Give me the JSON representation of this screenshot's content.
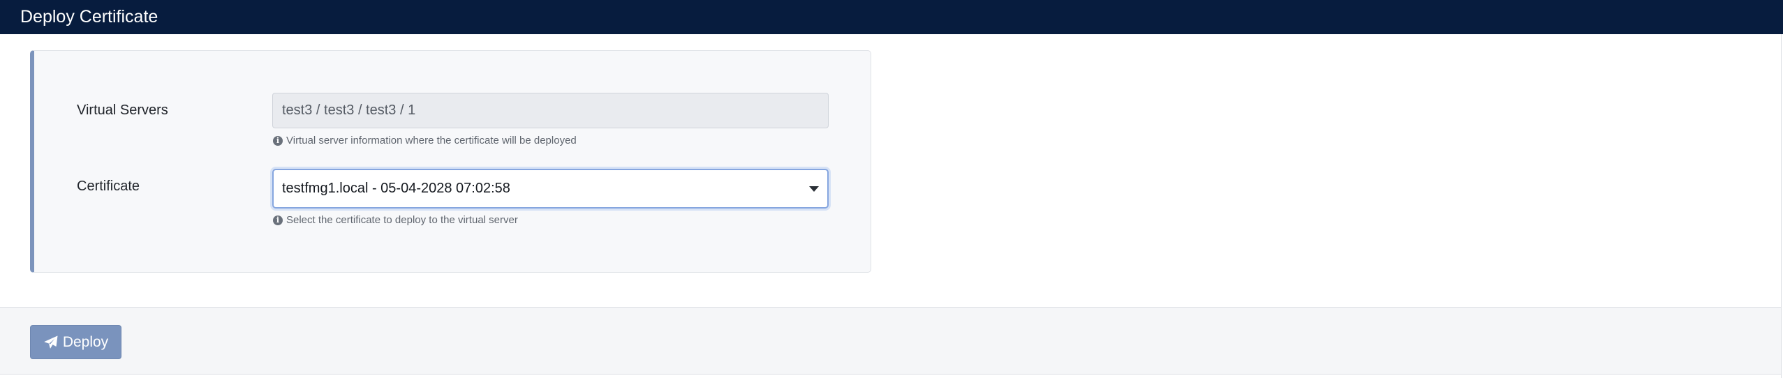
{
  "header": {
    "title": "Deploy Certificate"
  },
  "form": {
    "virtual_servers": {
      "label": "Virtual Servers",
      "value": "test3 / test3 / test3 / 1",
      "help": "Virtual server information where the certificate will be deployed"
    },
    "certificate": {
      "label": "Certificate",
      "selected": "testfmg1.local - 05-04-2028 07:02:58",
      "help": "Select the certificate to deploy to the virtual server"
    }
  },
  "footer": {
    "deploy_label": "Deploy"
  },
  "icons": {
    "info": "info-circle-icon",
    "deploy": "paper-plane-icon",
    "dropdown": "caret-down-icon"
  },
  "colors": {
    "header_bg": "#071c3e",
    "accent_border": "#7c94bc",
    "button_bg": "#7a93bd",
    "focus_border": "#86a6df"
  }
}
